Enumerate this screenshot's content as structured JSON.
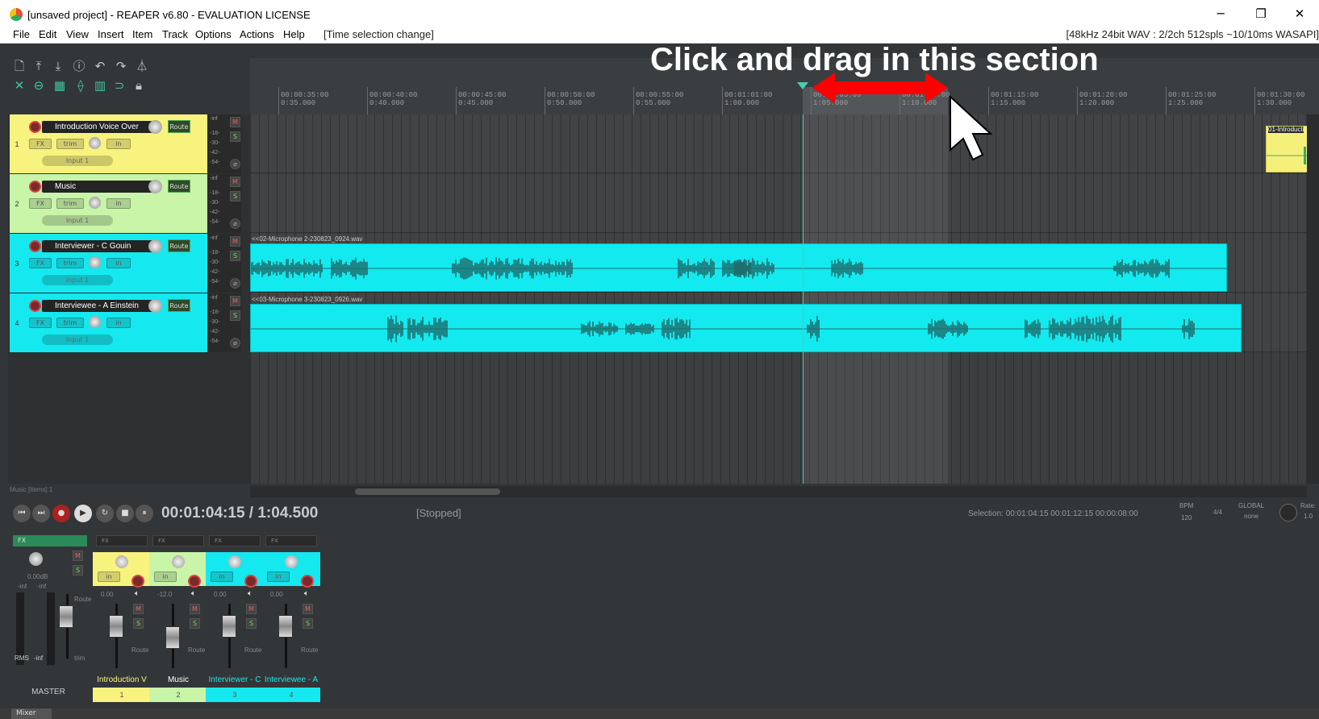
{
  "window": {
    "title": "[unsaved project] - REAPER v6.80 - EVALUATION LICENSE",
    "minimize": "─",
    "restore": "❐",
    "close": "✕"
  },
  "menu": {
    "items": [
      "File",
      "Edit",
      "View",
      "Insert",
      "Item",
      "Track",
      "Options",
      "Actions",
      "Help"
    ],
    "status": "[Time selection change]",
    "audio_info": "[48kHz 24bit WAV : 2/2ch 512spls ~10/10ms WASAPI]"
  },
  "annotation": "Click and drag in this section",
  "ruler": {
    "ticks": [
      {
        "time": "00:00:35:00",
        "beats": "0:35.000"
      },
      {
        "time": "00:00:40:00",
        "beats": "0:40.000"
      },
      {
        "time": "00:00:45:00",
        "beats": "0:45.000"
      },
      {
        "time": "00:00:50:00",
        "beats": "0:50.000"
      },
      {
        "time": "00:00:55:00",
        "beats": "0:55.000"
      },
      {
        "time": "00:01:01:00",
        "beats": "1:00.000"
      },
      {
        "time": "00:01:05:00",
        "beats": "1:05.000"
      },
      {
        "time": "00:01:10:00",
        "beats": "1:10.000"
      },
      {
        "time": "00:01:15:00",
        "beats": "1:15.000"
      },
      {
        "time": "00:01:20:00",
        "beats": "1:20.000"
      },
      {
        "time": "00:01:25:00",
        "beats": "1:25.000"
      },
      {
        "time": "00:01:30:00",
        "beats": "1:30.000"
      }
    ]
  },
  "tracks": [
    {
      "num": "1",
      "name": "Introduction Voice Over",
      "color": "#f8f37e",
      "input": "Input 1",
      "route": "Route",
      "fx": "FX",
      "trim": "trim",
      "in": "in"
    },
    {
      "num": "2",
      "name": "Music",
      "color": "#c8f5a8",
      "input": "Input 1",
      "route": "Route",
      "fx": "FX",
      "trim": "trim",
      "in": "in"
    },
    {
      "num": "3",
      "name": "Interviewer - C Gouin",
      "color": "#16e8ef",
      "input": "Input 1",
      "route": "Route",
      "fx": "FX",
      "trim": "trim",
      "in": "in"
    },
    {
      "num": "4",
      "name": "Interviewee - A Einstein",
      "color": "#16e8ef",
      "input": "Input 1",
      "route": "Route",
      "fx": "FX",
      "trim": "trim",
      "in": "in"
    }
  ],
  "meter_labels": {
    "inf": "-inf",
    "m": "M",
    "s": "S",
    "l18": "-18-",
    "l30": "-30-",
    "l42": "-42-",
    "l54": "-54-"
  },
  "items": {
    "item3": "<<02-Microphone 2-230823_0924.wav",
    "item4": "<<03-Microphone 3-230823_0926.wav",
    "item1": "01-Introducti"
  },
  "status_line": "Music [items] 1",
  "transport": {
    "time": "00:01:04:15 / 1:04.500",
    "state": "[Stopped]",
    "selection": "Selection:   00:01:04:15     00:01:12:15     00:00:08:00",
    "bpm_label": "BPM",
    "bpm": "120",
    "sig": "4/4",
    "global": "GLOBAL",
    "none": "none",
    "rate": "Rate:",
    "rate_val": "1.0"
  },
  "mixer": {
    "master_db": "0.00dB",
    "master_label": "MASTER",
    "rms": "RMS",
    "inf": "-inf",
    "trim": "trim",
    "fx": "FX",
    "route": "Route",
    "tab": "Mixer",
    "strips": [
      {
        "label": "Introduction V",
        "num": "1",
        "db": "0.00",
        "color": "#f8f37e",
        "text": "#f8f37e"
      },
      {
        "label": "Music",
        "num": "2",
        "db": "-12.0",
        "color": "#c8f5a8",
        "text": "#ffffff"
      },
      {
        "label": "Interviewer - C",
        "num": "3",
        "db": "0.00",
        "color": "#16e8ef",
        "text": "#16e8ef"
      },
      {
        "label": "Interviewee - A",
        "num": "4",
        "db": "0.00",
        "color": "#16e8ef",
        "text": "#16e8ef"
      }
    ]
  },
  "colors": {
    "accent_cyan": "#16e8ef",
    "yellow": "#f8f37e",
    "green": "#c8f5a8",
    "arrow_red": "#ff0000"
  }
}
